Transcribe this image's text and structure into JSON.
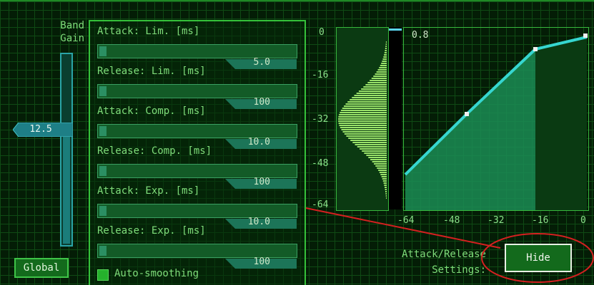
{
  "band_gain": {
    "label_line1": "Band",
    "label_line2": "Gain",
    "value": "12.5",
    "level_fraction": 0.6
  },
  "global_button": "Global",
  "sliders": [
    {
      "label": "Attack: Lim. [ms]",
      "value": "5.0"
    },
    {
      "label": "Release: Lim. [ms]",
      "value": "100"
    },
    {
      "label": "Attack: Comp. [ms]",
      "value": "10.0"
    },
    {
      "label": "Release: Comp. [ms]",
      "value": "100"
    },
    {
      "label": "Attack: Exp. [ms]",
      "value": "10.0"
    },
    {
      "label": "Release: Exp. [ms]",
      "value": "100"
    }
  ],
  "auto_smoothing": {
    "label": "Auto-smoothing",
    "checked": true
  },
  "y_axis": [
    "0",
    "-16",
    "-32",
    "-48",
    "-64"
  ],
  "x_axis": [
    "-64",
    "-48",
    "-32",
    "-16",
    "0"
  ],
  "graph_value": "0.8",
  "attack_release": {
    "line1": "Attack/Release",
    "line2": "Settings:"
  },
  "hide_button": "Hide",
  "colors": {
    "accent": "#35c23a",
    "curve": "#36d6d0",
    "fill": "#1c8e52",
    "annotation": "#d42020"
  }
}
